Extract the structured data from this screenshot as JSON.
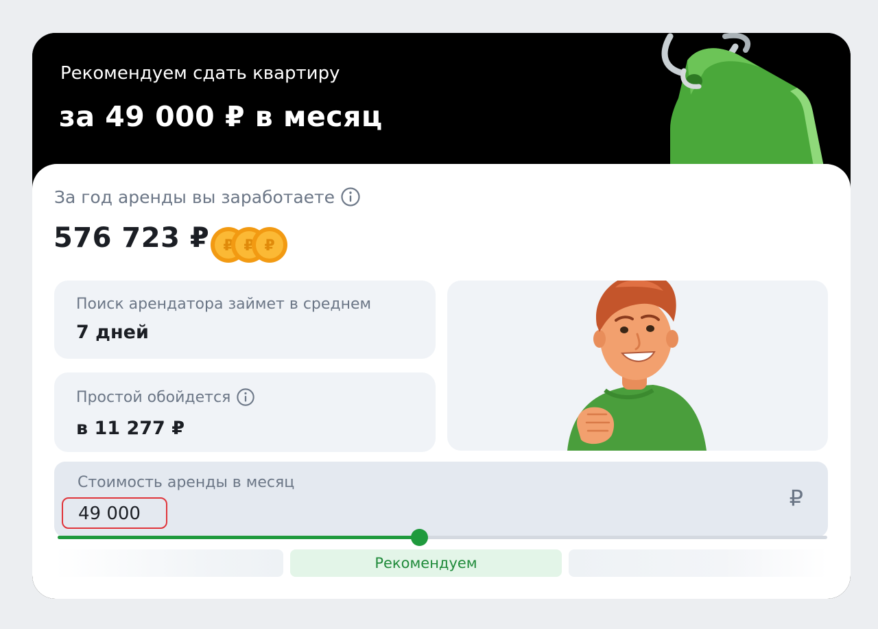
{
  "hero": {
    "subtitle": "Рекомендуем сдать квартиру",
    "title": "за 49 000 ₽ в месяц"
  },
  "annual": {
    "label": "За год аренды вы заработаете",
    "value": "576 723 ₽",
    "info_icon": "info-circle-icon",
    "coins_icon": "ruble-coins-icon"
  },
  "stats": [
    {
      "label": "Поиск арендатора займет в среднем",
      "value": "7 дней"
    },
    {
      "label": "Простой обойдется",
      "value": "в 11 277 ₽",
      "info_icon": "info-circle-icon"
    }
  ],
  "rent": {
    "label": "Стоимость аренды в месяц",
    "value": "49 000",
    "currency_symbol": "₽",
    "slider_fraction": 0.47
  },
  "range": {
    "recommended_label": "Рекомендуем"
  },
  "colors": {
    "accent_green": "#1f9a3d",
    "highlight_red": "#e0343a",
    "hero_background": "#000000",
    "panel_background": "#f0f3f7"
  }
}
